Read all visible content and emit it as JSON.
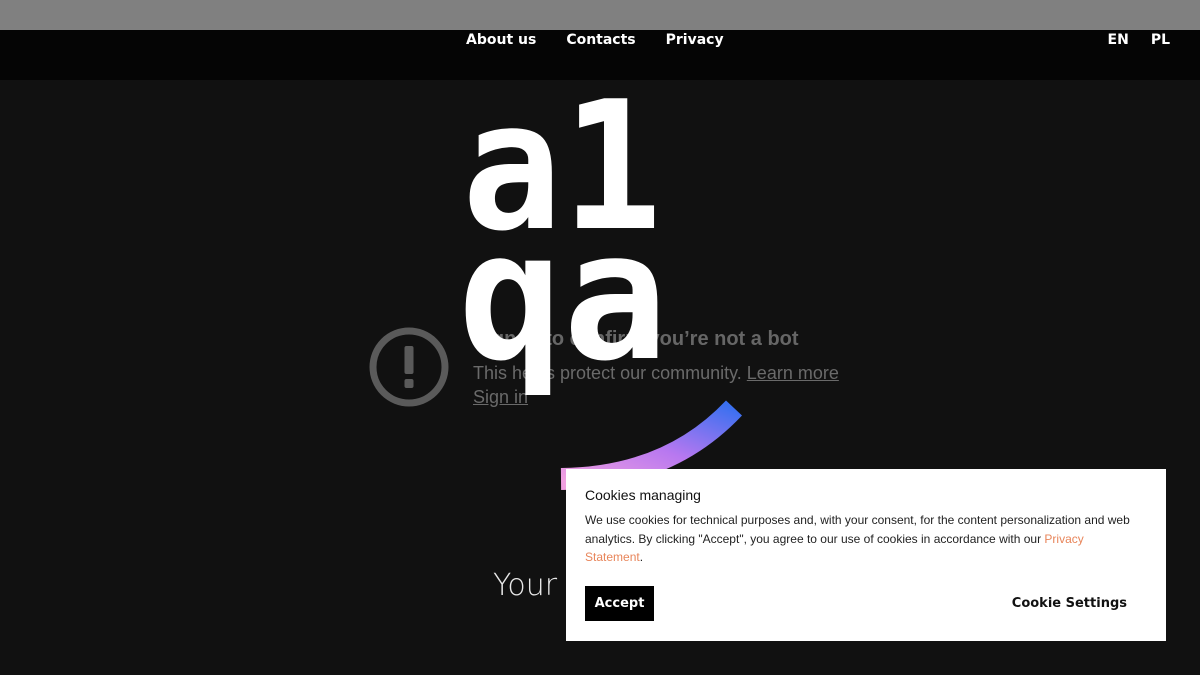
{
  "header": {
    "nav": [
      "About us",
      "Contacts",
      "Privacy"
    ],
    "languages": [
      "EN",
      "PL"
    ]
  },
  "logo": {
    "line1": "a1",
    "line2": "qa",
    "arc_colors": [
      "#f0a0e0",
      "#b878f0",
      "#3a70f0"
    ]
  },
  "bot_check": {
    "icon": "exclamation-circle-icon",
    "title": "Sign in to confirm you’re not a bot",
    "description": "This helps protect our community.",
    "learn_more": "Learn more",
    "sign_in": "Sign in"
  },
  "hero": {
    "text": "Your"
  },
  "cookies": {
    "title": "Cookies managing",
    "body": "We use cookies for technical purposes and, with your consent, for the content personalization and web analytics. By clicking \"Accept\", you agree to our use of cookies in accordance with our ",
    "privacy_link": "Privacy Statement",
    "body_end": ".",
    "accept_label": "Accept",
    "settings_label": "Cookie Settings",
    "link_color": "#e8855a"
  }
}
